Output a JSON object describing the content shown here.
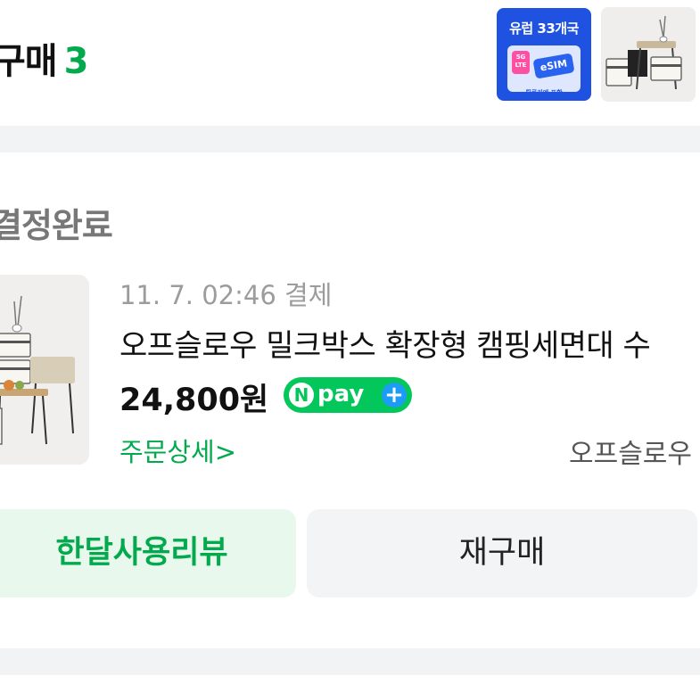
{
  "header": {
    "title": "구매",
    "count": "3"
  },
  "ads": [
    {
      "title": "유럽 33개국",
      "badge": "5G LTE",
      "sim_label": "eSIM",
      "caption": "튀르키예 포함",
      "icon": "esim-card-icon"
    },
    {
      "icon": "camping-furniture-image"
    }
  ],
  "order": {
    "status": "결정완료",
    "date": "11. 7. 02:46 결제",
    "product_name": "오프슬로우 밀크박스 확장형 캠핑세면대 수",
    "price": "24,800원",
    "npay": {
      "n": "N",
      "pay": "pay",
      "plus": "+"
    },
    "detail_link": "주문상세>",
    "seller": "오프슬로우"
  },
  "buttons": {
    "review": "한달사용리뷰",
    "rebuy": "재구매"
  },
  "colors": {
    "accent_green": "#03a94d",
    "npay_green": "#03c75a",
    "review_bg": "#e9f8ec",
    "rebuy_bg": "#f3f4f6",
    "separator": "#f2f3f5",
    "esim_blue": "#1f52e0"
  }
}
